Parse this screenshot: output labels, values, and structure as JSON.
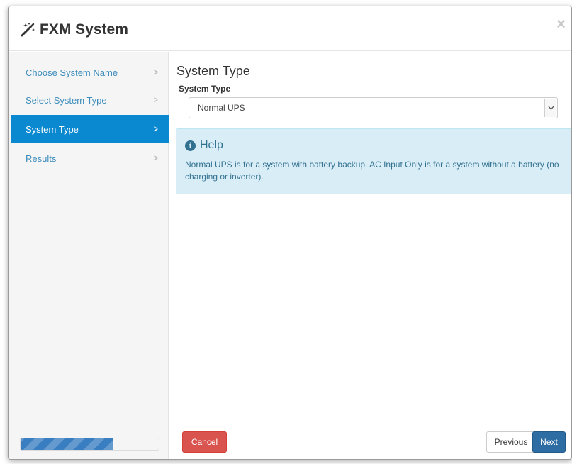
{
  "dialog": {
    "title": "FXM System",
    "close_glyph": "×"
  },
  "sidebar": {
    "steps": [
      {
        "label": "Choose System Name",
        "state": "done"
      },
      {
        "label": "Select System Type",
        "state": "done"
      },
      {
        "label": "System Type",
        "state": "active"
      },
      {
        "label": "Results",
        "state": "pending"
      }
    ],
    "chevron_glyph": ">",
    "progress_fraction": 0.67
  },
  "main": {
    "section_title": "System Type",
    "field_label": "System Type",
    "select_value": "Normal UPS",
    "help": {
      "icon": "info-icon",
      "title": "Help",
      "body": "Normal UPS is for a system with battery backup. AC Input Only is for a system without a battery (no charging or inverter)."
    }
  },
  "footer": {
    "cancel_label": "Cancel",
    "previous_label": "Previous",
    "next_label": "Next"
  },
  "colors": {
    "active_step": "#0a88d0",
    "link": "#3c8dbc",
    "help_bg": "#d9edf7",
    "help_text": "#31708f",
    "cancel": "#d9534f",
    "next": "#2e6da4"
  }
}
